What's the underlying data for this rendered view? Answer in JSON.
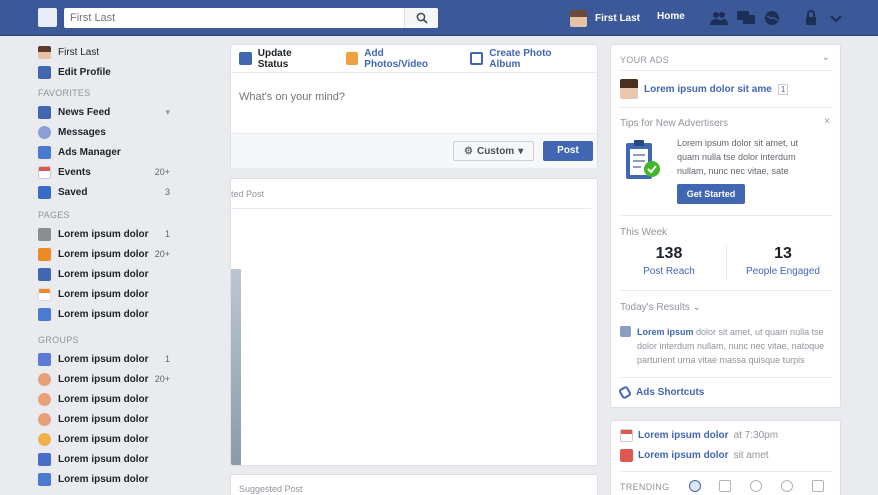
{
  "topbar": {
    "search_placeholder": "First Last",
    "user_name": "First Last",
    "home_label": "Home",
    "icons": [
      "friends-icon",
      "messages-icon",
      "globe-icon",
      "lock-icon",
      "chevron-down-icon"
    ]
  },
  "sidebar": {
    "profile_name": "First Last",
    "edit_profile": "Edit Profile",
    "favorites_title": "FAVORITES",
    "favorites": [
      {
        "label": "News Feed",
        "count": ""
      },
      {
        "label": "Messages",
        "count": ""
      },
      {
        "label": "Ads Manager",
        "count": ""
      },
      {
        "label": "Events",
        "count": "20+"
      },
      {
        "label": "Saved",
        "count": "3"
      }
    ],
    "pages_title": "PAGES",
    "pages": [
      {
        "label": "Lorem ipsum dolor",
        "count": "1"
      },
      {
        "label": "Lorem ipsum dolor",
        "count": "20+"
      },
      {
        "label": "Lorem ipsum dolor",
        "count": ""
      },
      {
        "label": "Lorem ipsum dolor",
        "count": ""
      },
      {
        "label": "Lorem ipsum dolor",
        "count": ""
      }
    ],
    "groups_title": "GROUPS",
    "groups": [
      {
        "label": "Lorem ipsum dolor",
        "count": "1"
      },
      {
        "label": "Lorem ipsum dolor",
        "count": "20+"
      },
      {
        "label": "Lorem ipsum dolor",
        "count": ""
      },
      {
        "label": "Lorem ipsum dolor",
        "count": ""
      },
      {
        "label": "Lorem ipsum dolor",
        "count": ""
      },
      {
        "label": "Lorem ipsum dolor",
        "count": ""
      },
      {
        "label": "Lorem ipsum dolor",
        "count": ""
      }
    ]
  },
  "composer": {
    "tab_status": "Update Status",
    "tab_photos": "Add Photos/Video",
    "tab_album": "Create Photo Album",
    "placeholder": "What's on your mind?",
    "audience": "Custom",
    "post_label": "Post"
  },
  "feed": {
    "card_label": "ted Post",
    "suggested_label": "Suggested Post"
  },
  "ads": {
    "your_ads": "YOUR ADS",
    "account_name": "Lorem ipsum dolor sit ame",
    "account_badge": "1",
    "tips_title": "Tips for New Advertisers",
    "tips_text": "Lorem ipsum dolor sit amet, ut quam nulla tse dolor interdum nullam, nunc nec vitae, sate",
    "get_started": "Get Started",
    "this_week": "This Week",
    "post_reach_value": "138",
    "post_reach_label": "Post Reach",
    "engaged_value": "13",
    "engaged_label": "People Engaged",
    "todays_results": "Today's Results",
    "today_bold": "Lorem ipsum",
    "today_text": " dolor sit amet, ut quam nulla tse dolor interdum nullam, nunc nec vitae, natoque parturient urna vitae massa quisque turpis",
    "ads_shortcuts": "Ads Shortcuts"
  },
  "events": {
    "event1": "Lorem ipsum dolor",
    "event1_time": "at 7:30pm",
    "event2": "Lorem ipsum dolor",
    "event2_meta": "sit amet",
    "trending": "TRENDING"
  },
  "colors": {
    "brand": "#3b5998",
    "link": "#4267b2",
    "background": "#e9ebee"
  }
}
